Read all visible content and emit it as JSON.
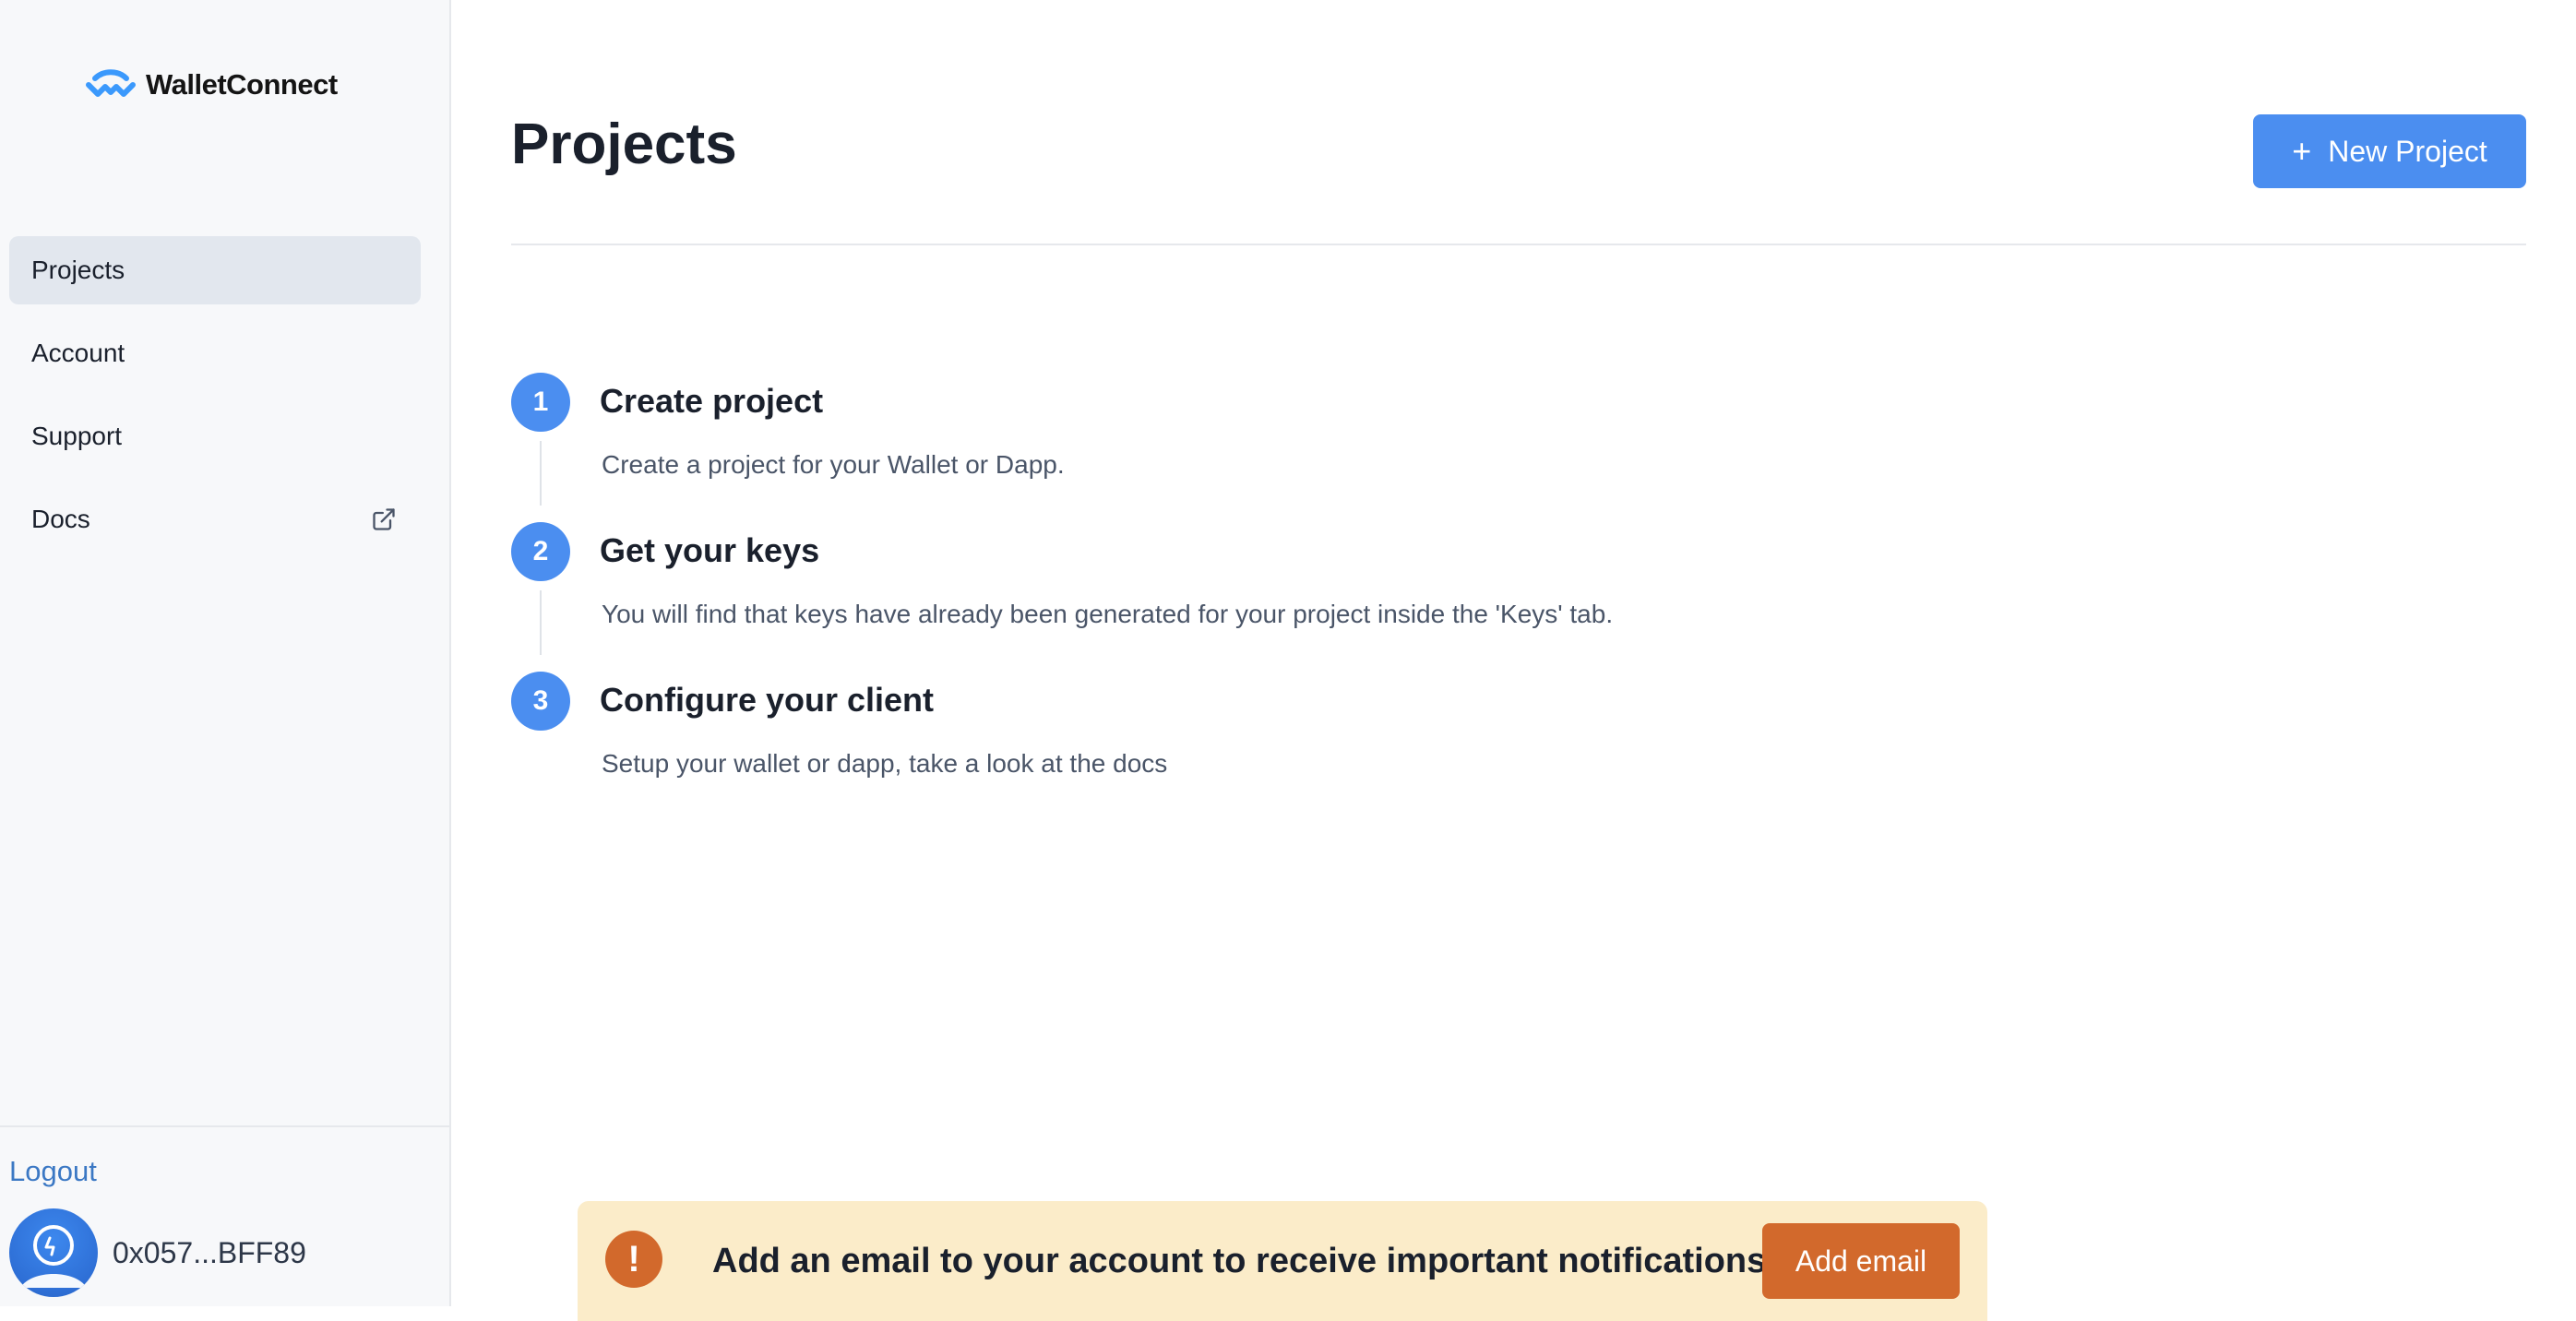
{
  "app": {
    "brand_name": "WalletConnect",
    "brand_color": "#3B99FC",
    "logo_icon": "walletconnect-logo-icon"
  },
  "sidebar": {
    "items": [
      {
        "label": "Projects",
        "active": true
      },
      {
        "label": "Account",
        "active": false
      },
      {
        "label": "Support",
        "active": false
      },
      {
        "label": "Docs",
        "active": false,
        "icon": "external-link-icon"
      }
    ],
    "logout_label": "Logout",
    "user": {
      "address": "0x057...BFF89",
      "avatar_icon": "avatar-icon"
    }
  },
  "main": {
    "title": "Projects",
    "new_project_label": "New Project",
    "new_project_icon": "plus-icon",
    "accent_color": "#4B8EF0",
    "steps": [
      {
        "number": "1",
        "title": "Create project",
        "description": "Create a project for your Wallet or Dapp."
      },
      {
        "number": "2",
        "title": "Get your keys",
        "description": "You will find that keys have already been generated for your project inside the 'Keys' tab."
      },
      {
        "number": "3",
        "title": "Configure your client",
        "description": "Setup your wallet or dapp, take a look at the docs"
      }
    ]
  },
  "banner": {
    "message": "Add an email to your account to receive important notifications.",
    "button_label": "Add email",
    "icon": "exclamation-icon",
    "icon_glyph": "!",
    "background_color": "#FBECC9",
    "accent_color": "#D2692C"
  }
}
